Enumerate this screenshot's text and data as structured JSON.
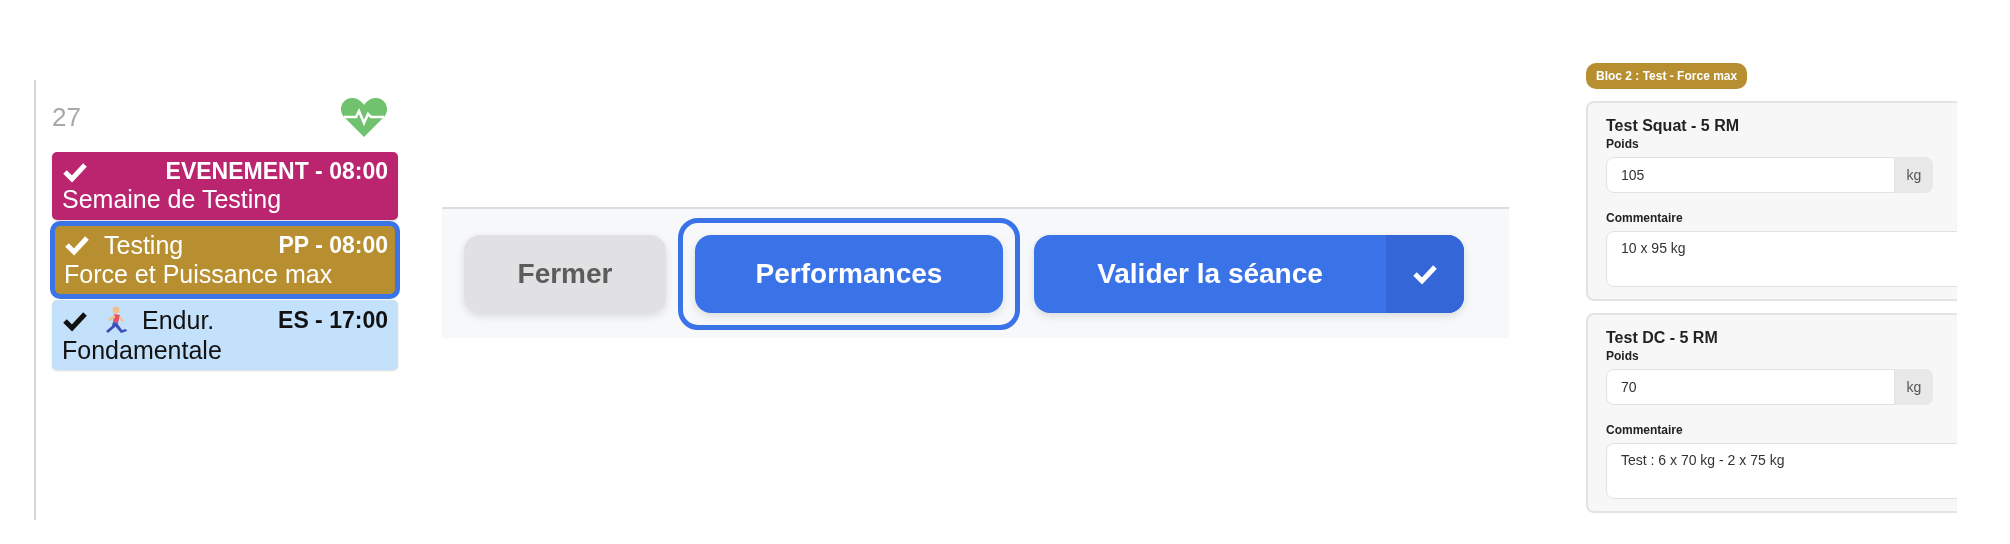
{
  "calendar": {
    "day": "27",
    "events": [
      {
        "kind": "plain",
        "checked": true,
        "selected": false,
        "color": "#bb2570",
        "tag": "EVENEMENT - 08:00",
        "title": "Semaine de Testing"
      },
      {
        "kind": "plain",
        "checked": true,
        "selected": true,
        "color": "#b78f30",
        "name": "Testing",
        "tag": "PP - 08:00",
        "title": "Force et Puissance max"
      },
      {
        "kind": "running",
        "checked": true,
        "selected": false,
        "color": "#c4e1fb",
        "name": "Endur.",
        "tag": "ES - 17:00",
        "title": "Fondamentale"
      }
    ]
  },
  "actions": {
    "buttons": [
      {
        "kind": "secondary",
        "label": "Fermer",
        "focused": false
      },
      {
        "kind": "primary",
        "label": "Performances",
        "focused": true
      },
      {
        "kind": "split",
        "label": "Valider la séance",
        "focused": false
      }
    ]
  },
  "block": {
    "badge": "Bloc 2 : Test - Force max",
    "exercises": [
      {
        "title": "Test Squat - 5 RM",
        "weight_label": "Poids",
        "weight": "105",
        "unit": "kg",
        "comment_label": "Commentaire",
        "comment": "10 x 95 kg"
      },
      {
        "title": "Test DC - 5 RM",
        "weight_label": "Poids",
        "weight": "70",
        "unit": "kg",
        "comment_label": "Commentaire",
        "comment": "Test : 6 x 70 kg - 2 x 75 kg"
      }
    ]
  }
}
